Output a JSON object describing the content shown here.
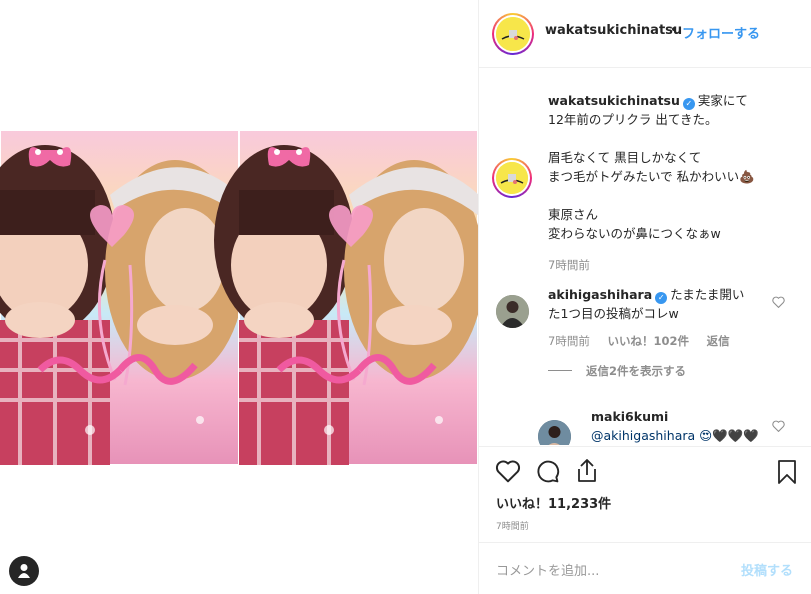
{
  "post": {
    "username": "wakatsukichinatsu",
    "dot": "•",
    "follow_label": "フォローする"
  },
  "caption": {
    "username": "wakatsukichinatsu",
    "lines": [
      "実家にて",
      "12年前のプリクラ 出てきた。",
      "",
      "眉毛なくて 黒目しかなくて",
      "まつ毛がトゲみたいで 私かわいい💩",
      "",
      "東原さん",
      "変わらないのが鼻につくなぁw"
    ],
    "time": "7時間前"
  },
  "comment1": {
    "username": "akihigashihara",
    "line1": "たまたま開い",
    "line2": "た1つ目の投稿がコレw",
    "time": "7時間前",
    "likes": "いいね！102件",
    "reply": "返信",
    "view_replies": "返信2件を表示する"
  },
  "comment2": {
    "username": "maki6kumi",
    "text": "@akihigashihara 😍🖤🖤🖤"
  },
  "likes_label": "いいね！11,233件",
  "post_time": "7時間前",
  "comment_box": {
    "placeholder": "コメントを追加...",
    "post_label": "投稿する"
  },
  "icons": [
    "heart-icon",
    "comment-icon",
    "share-icon",
    "bookmark-icon",
    "user-icon",
    "heart-outline-icon"
  ],
  "colors": {
    "link": "#3897f0",
    "verified": "#3897f0",
    "muted": "#8e8e8e"
  }
}
